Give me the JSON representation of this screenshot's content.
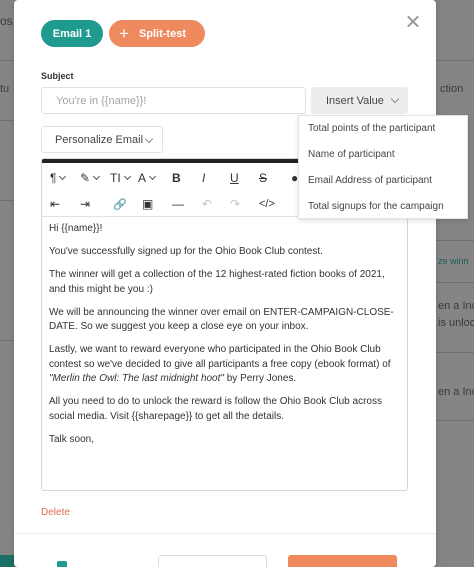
{
  "background": {
    "fragments": [
      "os",
      "tu",
      "ction",
      "ze winn",
      "en a Inc",
      "is unloc",
      "en a Ince"
    ]
  },
  "modal": {
    "tabs": {
      "email": "Email 1",
      "split": "Split-test"
    },
    "subject": {
      "label": "Subject",
      "value": "You're in {{name}}!"
    },
    "insert_value": {
      "label": "Insert Value",
      "options": [
        "Total points of the participant",
        "Name of participant",
        "Email Address of participant",
        "Total signups for the campaign"
      ]
    },
    "personalize": {
      "label": "Personalize Email"
    },
    "toolbar": {
      "paragraph": "¶",
      "magic": "✎",
      "text_size": "TI",
      "font": "A",
      "bold": "B",
      "italic": "I",
      "underline": "U",
      "strike": "S",
      "color": "●",
      "outdent": "⇤",
      "indent": "⇥",
      "link": "🔗",
      "image": "▣",
      "hr": "—",
      "undo": "↶",
      "redo": "↷",
      "code": "</>"
    },
    "email_body": {
      "greeting": "Hi {{name}}!",
      "p1": "You've successfully signed up for the Ohio Book Club contest.",
      "p2": "The winner will get a collection of the 12 highest-rated fiction books of 2021, and this might be you :)",
      "p3": "We will be announcing the winner over email on ENTER-CAMPAIGN-CLOSE-DATE. So we suggest you keep a close eye on your inbox.",
      "p4_start": "Lastly, we want to reward everyone who participated in the Ohio Book Club contest so we've decided to give all participants a free copy (ebook format) of ",
      "p4_book": "\"Merlin the Owl: The last midnight hoot\"",
      "p4_end": " by Perry Jones.",
      "p5": "All you need to do to unlock the reward is follow the Ohio Book Club across social media. Visit {{sharepage}} to get all the details.",
      "closing": "Talk soon,"
    },
    "delete_label": "Delete"
  },
  "colors": {
    "teal": "#1f9a8f",
    "orange": "#ef8a5e",
    "delete_red": "#e26a5a",
    "overlay": "#858585"
  }
}
